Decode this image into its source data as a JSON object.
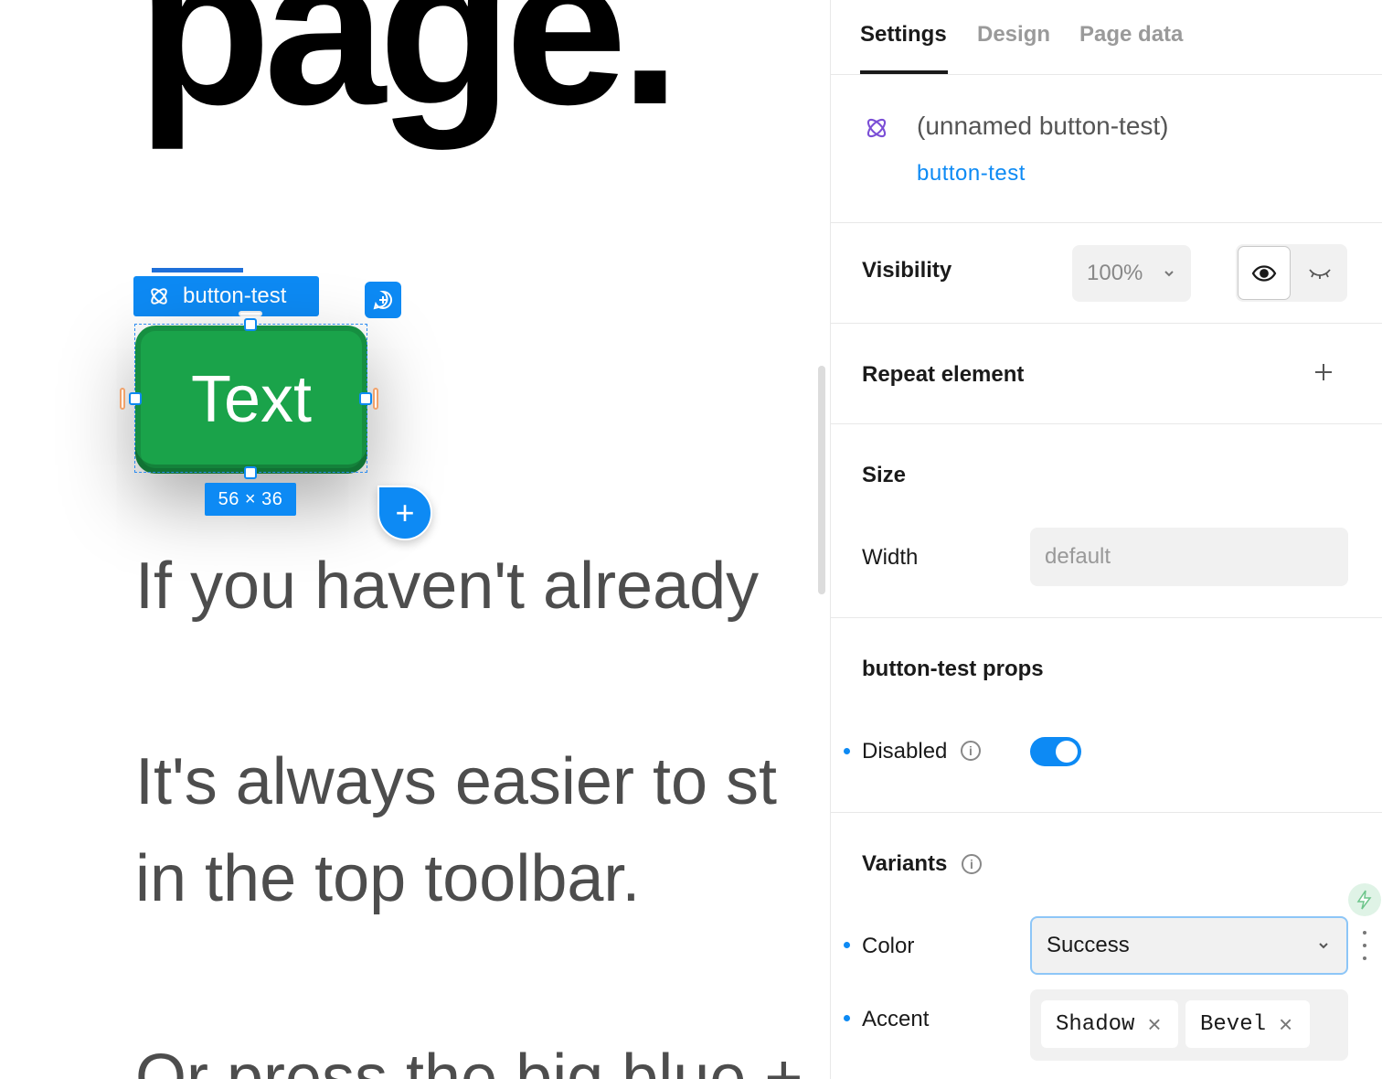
{
  "canvas": {
    "heading": "page.",
    "paragraphs": [
      "If you haven't already",
      "It's always easier to st\nin the top toolbar.",
      "Or press the big blue +"
    ],
    "selection": {
      "label": "button-test",
      "button_text": "Text",
      "dimensions": "56 × 36"
    },
    "add_button_glyph": "+"
  },
  "panel": {
    "tabs": [
      {
        "label": "Settings",
        "active": true
      },
      {
        "label": "Design",
        "active": false
      },
      {
        "label": "Page data",
        "active": false
      }
    ],
    "component": {
      "name": "(unnamed button-test)",
      "link": "button-test",
      "icon": "component-icon",
      "icon_color": "#7b4fd6"
    },
    "visibility": {
      "label": "Visibility",
      "opacity": "100%",
      "visible": true
    },
    "repeat": {
      "label": "Repeat element"
    },
    "size": {
      "label": "Size",
      "width_label": "Width",
      "width_placeholder": "default"
    },
    "props": {
      "title": "button-test props",
      "disabled_label": "Disabled",
      "disabled_value": true
    },
    "variants": {
      "title": "Variants",
      "color_label": "Color",
      "color_value": "Success",
      "accent_label": "Accent",
      "accent_values": [
        "Shadow",
        "Bevel"
      ]
    }
  },
  "colors": {
    "accent": "#0d8af4",
    "button_green": "#1aa34a"
  }
}
